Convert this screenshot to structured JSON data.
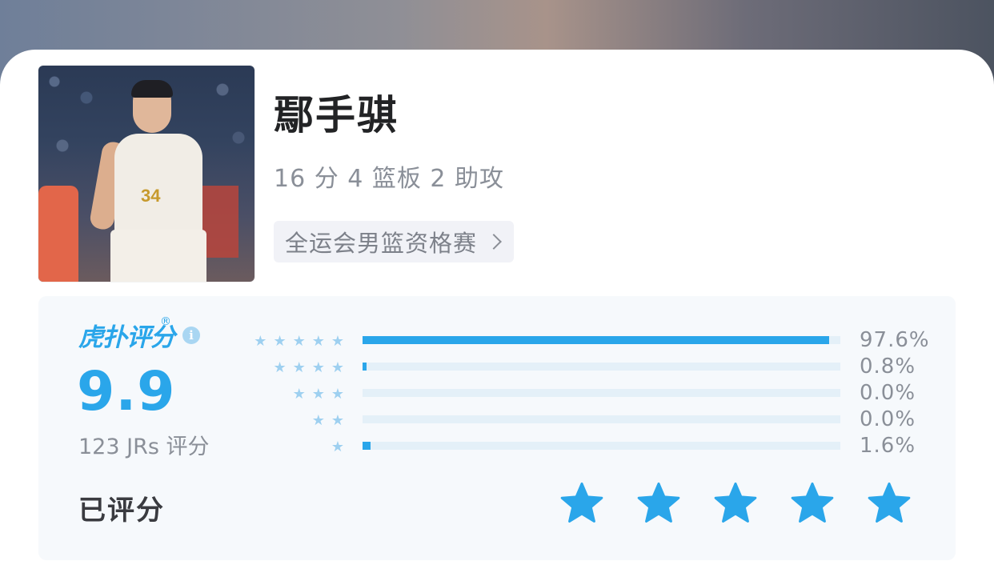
{
  "player": {
    "name": "鄢手骐",
    "stats": "16 分 4 篮板 2 助攻",
    "event_tag": "全运会男篮资格赛",
    "jersey_number": "34"
  },
  "rating": {
    "logo_text": "虎扑评分",
    "logo_reg": "®",
    "info_icon": "i",
    "score": "9.9",
    "votes": "123 JRs 评分",
    "rows": [
      {
        "stars": 5,
        "percent": 97.6,
        "label": "97.6%"
      },
      {
        "stars": 4,
        "percent": 0.8,
        "label": "0.8%"
      },
      {
        "stars": 3,
        "percent": 0.0,
        "label": "0.0%"
      },
      {
        "stars": 2,
        "percent": 0.0,
        "label": "0.0%"
      },
      {
        "stars": 1,
        "percent": 1.6,
        "label": "1.6%"
      }
    ],
    "rated_label": "已评分",
    "user_stars": 5
  },
  "colors": {
    "accent": "#2aa6ea",
    "star_light": "#9ed0f0",
    "track": "#e4f0f8",
    "muted_text": "#8a8f98"
  },
  "icons": {
    "chevron": "chevron-right-icon",
    "info": "info-icon",
    "star": "star-icon"
  }
}
